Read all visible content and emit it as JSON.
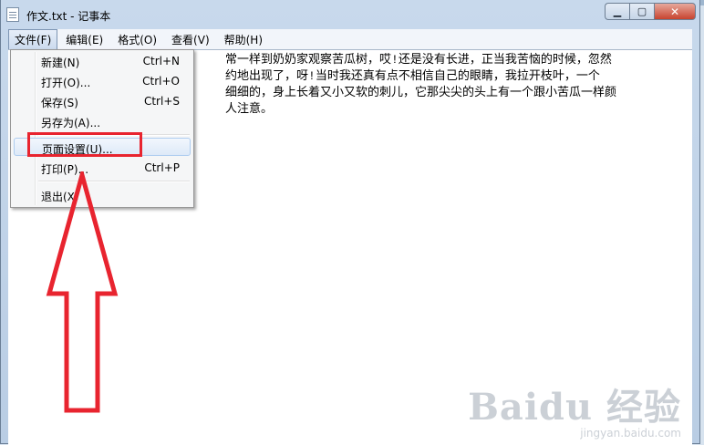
{
  "window": {
    "title": "作文.txt - 记事本",
    "buttons": {
      "minimize_glyph": "▁",
      "maximize_glyph": "▢",
      "close_glyph": "✕"
    }
  },
  "menubar": {
    "items": [
      {
        "label": "文件(F)"
      },
      {
        "label": "编辑(E)"
      },
      {
        "label": "格式(O)"
      },
      {
        "label": "查看(V)"
      },
      {
        "label": "帮助(H)"
      }
    ]
  },
  "file_menu": {
    "items": [
      {
        "label": "新建(N)",
        "shortcut": "Ctrl+N"
      },
      {
        "label": "打开(O)...",
        "shortcut": "Ctrl+O"
      },
      {
        "label": "保存(S)",
        "shortcut": "Ctrl+S"
      },
      {
        "label": "另存为(A)...",
        "shortcut": ""
      },
      {
        "label": "页面设置(U)...",
        "shortcut": ""
      },
      {
        "label": "打印(P)...",
        "shortcut": "Ctrl+P"
      },
      {
        "label": "退出(X)",
        "shortcut": ""
      }
    ]
  },
  "editor": {
    "text": "                              常一样到奶奶家观察苦瓜树，哎!还是没有长进，正当我苦恼的时候，忽然\n                              约地出现了，呀!当时我还真有点不相信自己的眼睛，我拉开枝叶，一个\n                              细细的，身上长着又小又软的刺儿，它那尖尖的头上有一个跟小苦瓜一样颜\n                              人注意。"
  },
  "annotation": {
    "color": "#e8242f"
  },
  "watermark": {
    "logo": "Baidu 经验",
    "url": "jingyan.baidu.com"
  }
}
